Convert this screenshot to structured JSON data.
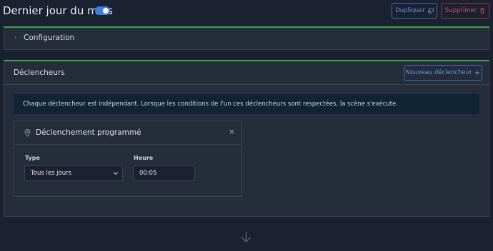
{
  "header": {
    "title": "Dernier jour du mois",
    "toggle_on": true,
    "duplicate_label": "Dupliquer",
    "delete_label": "Supprimer"
  },
  "config_panel": {
    "title": "Configuration"
  },
  "triggers_panel": {
    "title": "Déclencheurs",
    "new_trigger_label": "Nouveau déclencheur",
    "info_text": "Chaque déclencheur est indépendant. Lorsque les conditions de l'un ces déclencheurs sont respectées, la scène s'exécute.",
    "card": {
      "title": "Déclenchement programmé",
      "type_label": "Type",
      "type_value": "Tous les jours",
      "hour_label": "Heure",
      "hour_value": "00:05"
    }
  },
  "colors": {
    "background": "#1b2130",
    "panel": "#252c3a",
    "accent_green": "#3fa74a",
    "accent_blue": "#5d9ae8",
    "danger": "#d05454"
  },
  "icons": {
    "duplicate": "copy-icon",
    "delete": "trash-icon",
    "add": "plus-icon",
    "expand": "chevron-right-icon",
    "trigger": "pin-icon",
    "close": "close-icon",
    "flow": "arrow-down-icon"
  }
}
